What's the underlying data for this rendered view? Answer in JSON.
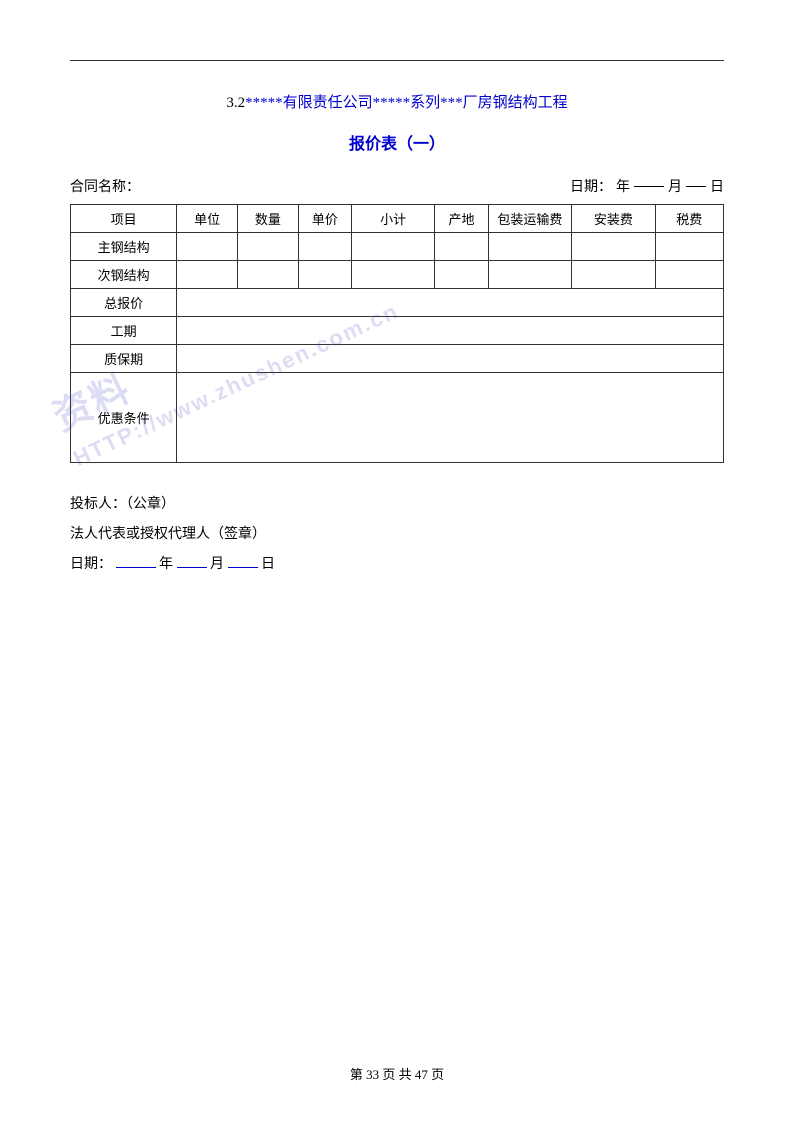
{
  "page": {
    "top_line": true,
    "section_title": {
      "prefix": "3.2",
      "blue_part": "*****有限责任公司*****系列***厂房钢结构工程"
    },
    "report_title": "报价表（一）",
    "contract_label": "合同名称：",
    "date_label": "日期：",
    "date_year": "年",
    "date_month": "月",
    "date_day": "日",
    "table": {
      "headers": [
        "项目",
        "单位",
        "数量",
        "单价",
        "小计",
        "产地",
        "包装运输费",
        "安装费",
        "税费"
      ],
      "rows": [
        {
          "label": "主钢结构",
          "cells": [
            "",
            "",
            "",
            "",
            "",
            "",
            "",
            ""
          ]
        },
        {
          "label": "次钢结构",
          "cells": [
            "",
            "",
            "",
            "",
            "",
            "",
            "",
            ""
          ]
        },
        {
          "label": "总报价",
          "cells_merged": true
        },
        {
          "label": "工期",
          "cells_merged": true
        },
        {
          "label": "质保期",
          "cells_merged": true
        },
        {
          "label": "优惠条件",
          "cells_merged": true,
          "tall": true
        }
      ]
    },
    "footer": {
      "bidder_label": "投标人：",
      "bidder_value": "（公章）",
      "legal_rep_label": "法人代表或授权代理人（签章）",
      "date_label": "日期：",
      "date_fields": [
        "年",
        "月",
        "日"
      ]
    },
    "pagination": {
      "current": "33",
      "total": "47",
      "text": "第 33 页 共 47 页"
    },
    "watermark": {
      "line1": "资料",
      "line2": "HTTP://www.zhushen.com.cn",
      "line3": ""
    }
  }
}
